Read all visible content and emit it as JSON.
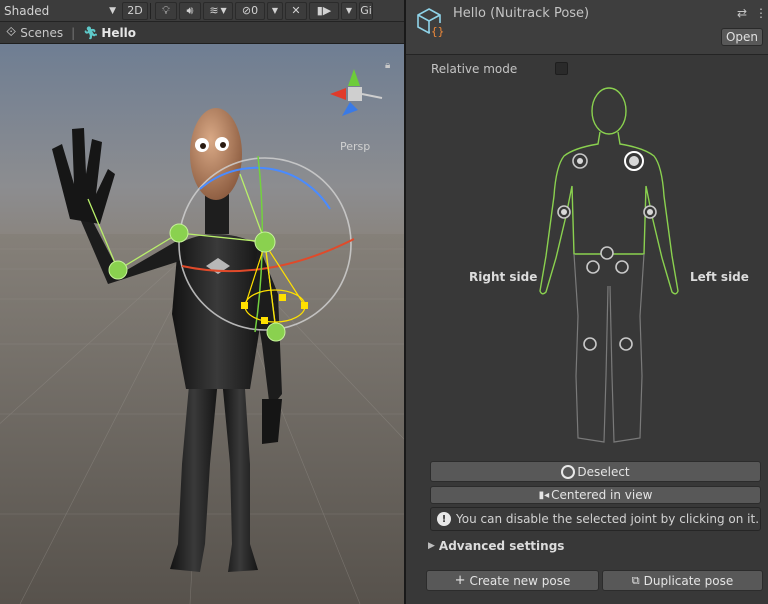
{
  "scene": {
    "toolbar": {
      "shading_mode": "Shaded",
      "mode_2d": "2D",
      "hidden_count": "0",
      "gizmos_label": "Gi"
    },
    "breadcrumb": {
      "scenes_label": "Scenes",
      "current": "Hello"
    },
    "viewport": {
      "projection_label": "Persp"
    }
  },
  "inspector": {
    "title": "Hello (Nuitrack Pose)",
    "open_label": "Open",
    "relative_mode_label": "Relative mode",
    "relative_mode_checked": false,
    "right_side_label": "Right side",
    "left_side_label": "Left side",
    "deselect_label": "Deselect",
    "centered_label": "Centered in view",
    "hint_text": "You can disable the selected joint by clicking on it.",
    "advanced_label": "Advanced settings",
    "create_label": "Create new pose",
    "duplicate_label": "Duplicate pose"
  },
  "colors": {
    "accent_green": "#8ad14f",
    "gizmo_yellow": "#ffe000",
    "panel_bg": "#383838"
  }
}
